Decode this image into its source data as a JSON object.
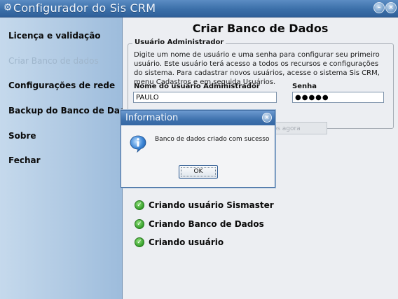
{
  "window": {
    "title": "Configurador do Sis CRM",
    "app_icon": "gear-icon"
  },
  "sidebar": {
    "items": [
      {
        "label": "Licença e validação",
        "enabled": true
      },
      {
        "label": "Criar Banco de dados",
        "enabled": false
      },
      {
        "label": "Configurações de rede",
        "enabled": true
      },
      {
        "label": "Backup do Banco de Dados",
        "enabled": true
      },
      {
        "label": "Sobre",
        "enabled": true
      },
      {
        "label": "Fechar",
        "enabled": true
      }
    ]
  },
  "main": {
    "heading": "Criar Banco de Dados",
    "group_title": "Usuário Administrador",
    "description": "Digite um nome de usuário e uma senha para configurar seu primeiro usuário. Este usuário terá acesso a todos os recursos e configurações do sistema. Para cadastrar novos usuários, acesse o sistema Sis CRM, menu Cadastros e em seguida Usuários.",
    "username_label": "Nome do usuário Administrador",
    "username_value": "PAULO",
    "password_label": "Senha",
    "password_value": "●●●●●",
    "create_button_visible_text": "dos agora",
    "steps": [
      {
        "label": "Criando usuário Sismaster"
      },
      {
        "label": "Criando Banco de Dados"
      },
      {
        "label": "Criando usuário"
      }
    ]
  },
  "dialog": {
    "title": "Information",
    "message": "Banco de dados criado com sucesso",
    "ok_label": "OK"
  },
  "colors": {
    "titlebar": "#3b6fa8",
    "sidebar": "#b2cbe4",
    "success": "#2f9a25"
  }
}
